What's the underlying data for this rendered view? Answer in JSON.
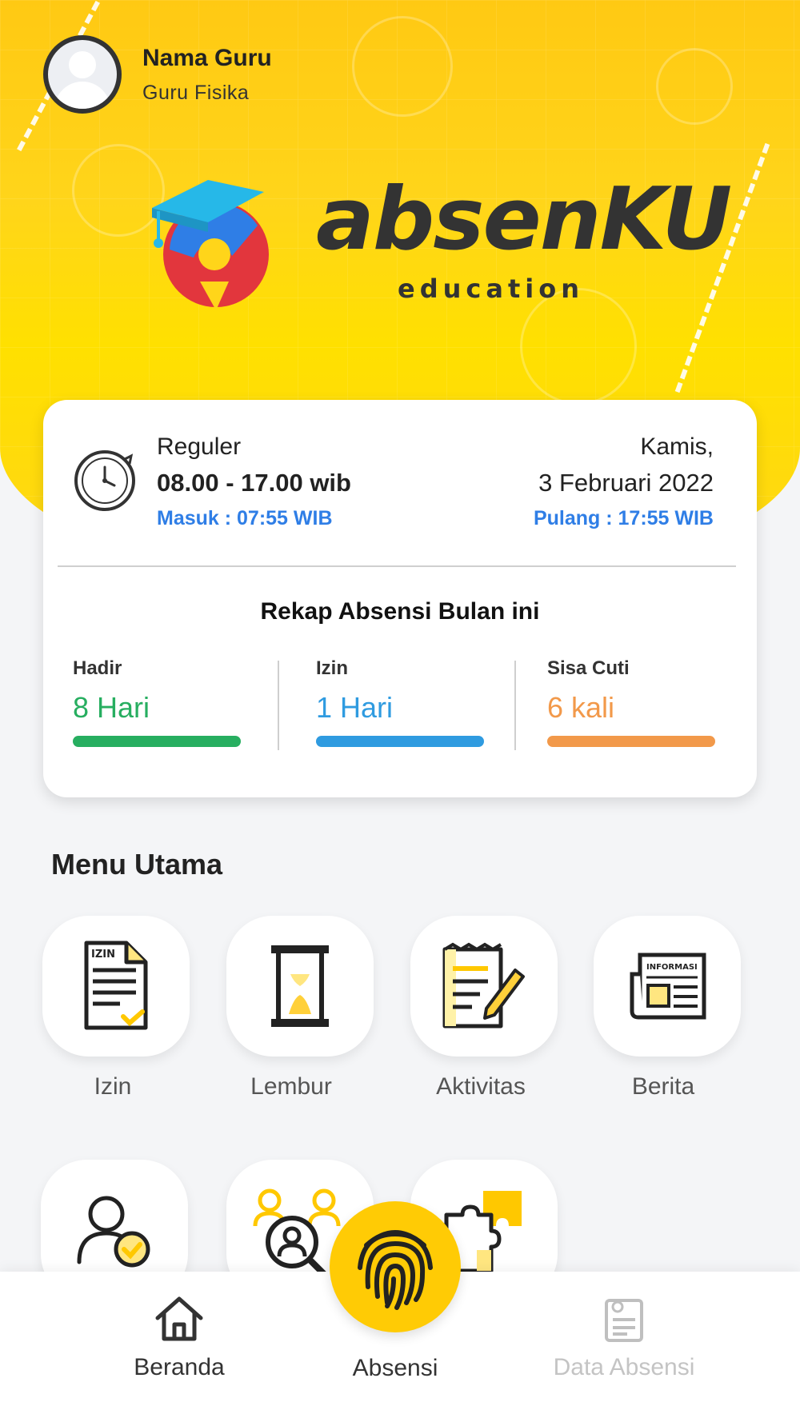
{
  "profile": {
    "name": "Nama Guru",
    "role": "Guru Fisika"
  },
  "brand": {
    "name": "absenKU",
    "subtitle": "education"
  },
  "shift": {
    "type": "Reguler",
    "hours": "08.00 - 17.00 wib",
    "check_in": "Masuk : 07:55 WIB",
    "day": "Kamis,",
    "date": "3 Februari 2022",
    "check_out": "Pulang : 17:55 WIB"
  },
  "recap": {
    "title": "Rekap Absensi Bulan ini",
    "stats": [
      {
        "label": "Hadir",
        "value": "8 Hari",
        "color": "#27AE60"
      },
      {
        "label": "Izin",
        "value": "1 Hari",
        "color": "#2F9BE0"
      },
      {
        "label": "Sisa Cuti",
        "value": "6 kali",
        "color": "#F2994A"
      }
    ]
  },
  "menu": {
    "title": "Menu Utama",
    "items": [
      {
        "label": "Izin",
        "icon": "permit-document-icon",
        "icon_text": "IZIN"
      },
      {
        "label": "Lembur",
        "icon": "hourglass-icon"
      },
      {
        "label": "Aktivitas",
        "icon": "activity-notepad-icon"
      },
      {
        "label": "Berita",
        "icon": "newspaper-icon",
        "icon_text": "INFORMASI"
      },
      {
        "label": "",
        "icon": "user-check-icon"
      },
      {
        "label": "",
        "icon": "user-search-icon"
      },
      {
        "label": "",
        "icon": "puzzle-icon"
      }
    ]
  },
  "bottom_nav": {
    "items": [
      {
        "label": "Beranda",
        "icon": "home-icon",
        "active": true
      },
      {
        "label": "Absensi",
        "icon": "fingerprint-icon",
        "active": true
      },
      {
        "label": "Data Absensi",
        "icon": "clipboard-icon",
        "active": false
      }
    ]
  },
  "colors": {
    "primary": "#FFCB05",
    "accent_blue": "#2F7EE6"
  }
}
